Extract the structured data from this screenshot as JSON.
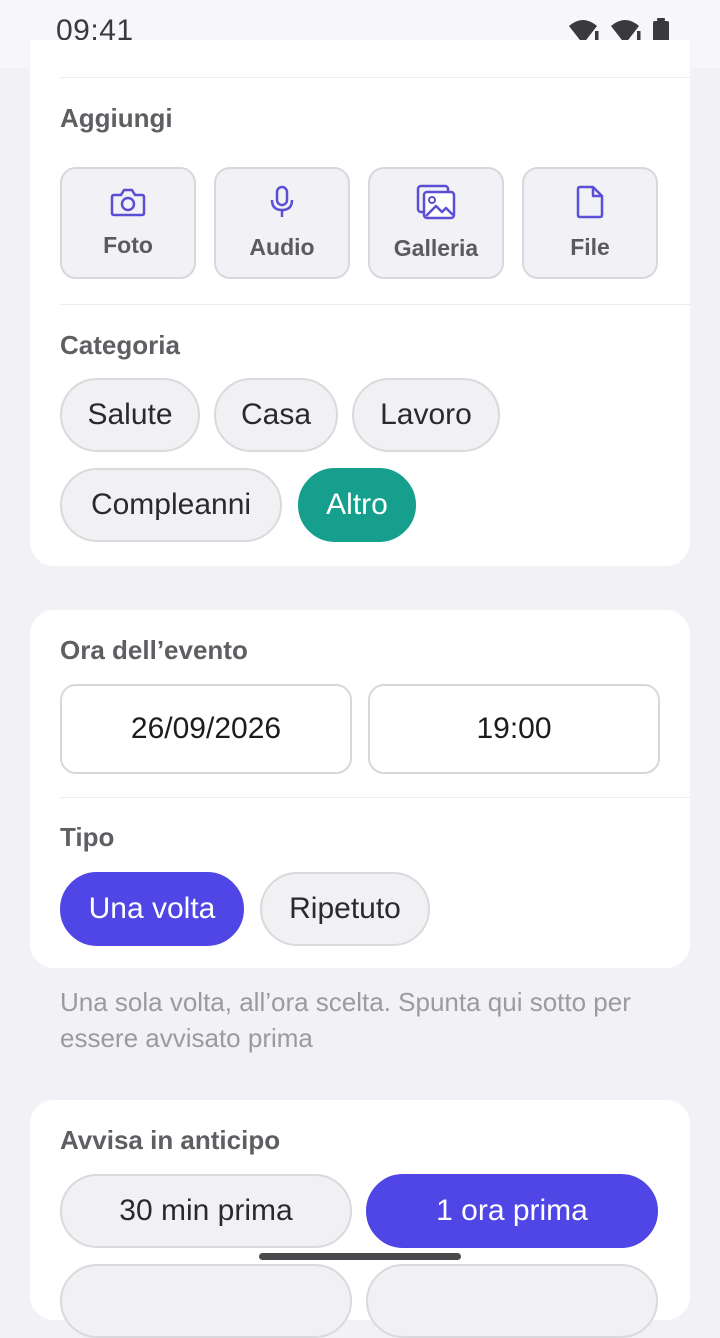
{
  "status_bar": {
    "time": "09:41",
    "icons": [
      "wifi-alert-icon",
      "wifi-alert-icon",
      "battery-icon"
    ]
  },
  "add_section": {
    "title": "Aggiungi",
    "buttons": [
      {
        "label": "Foto",
        "icon": "camera-icon"
      },
      {
        "label": "Audio",
        "icon": "microphone-icon"
      },
      {
        "label": "Galleria",
        "icon": "gallery-icon"
      },
      {
        "label": "File",
        "icon": "file-icon"
      }
    ]
  },
  "category_section": {
    "title": "Categoria",
    "chips": [
      "Salute",
      "Casa",
      "Lavoro",
      "Compleanni",
      "Altro"
    ],
    "selected": "Altro"
  },
  "event_time_section": {
    "title": "Ora dell’evento",
    "date_value": "26/09/2026",
    "time_value": "19:00"
  },
  "type_section": {
    "title": "Tipo",
    "chips": [
      "Una volta",
      "Ripetuto"
    ],
    "selected": "Una volta"
  },
  "hint_text": "Una sola volta, all’ora scelta. Spunta qui sotto per essere avvisato prima",
  "advance_section": {
    "title": "Avvisa in anticipo",
    "chips": [
      "30 min prima",
      "1 ora prima"
    ],
    "selected": "1 ora prima"
  },
  "colors": {
    "accent_indigo": "#4f46e5",
    "accent_teal": "#169f8d",
    "icon_purple": "#5b4fd6",
    "background": "#f2f1f6"
  }
}
